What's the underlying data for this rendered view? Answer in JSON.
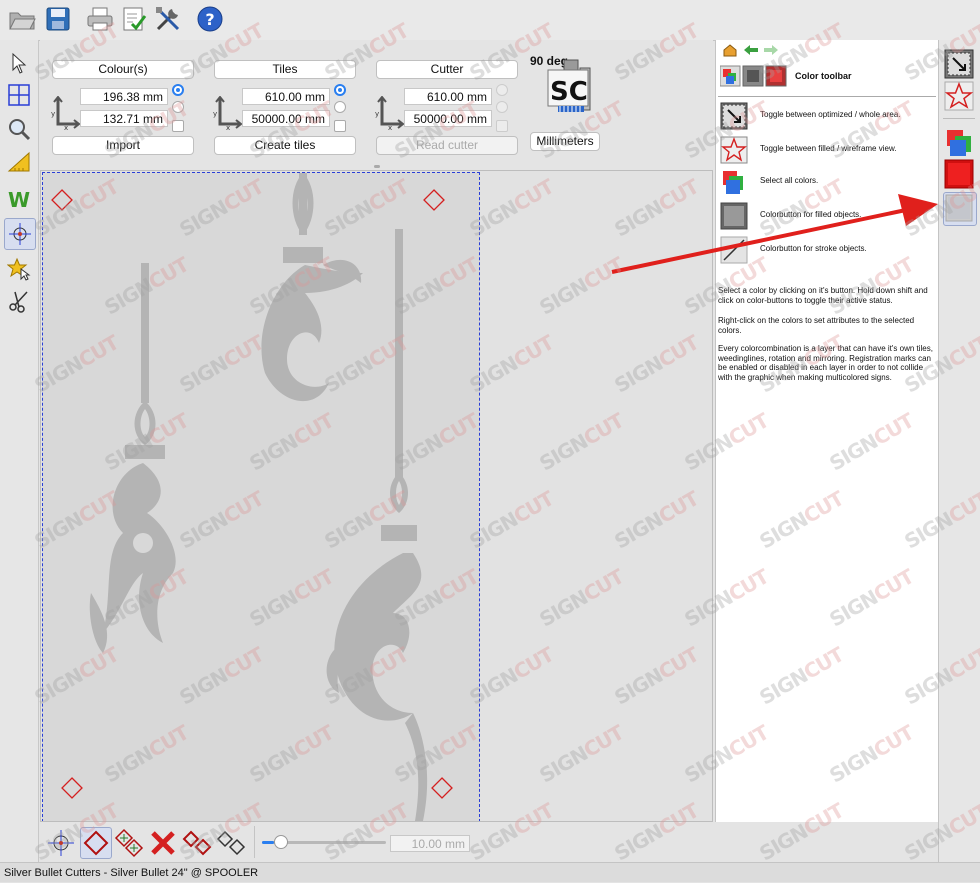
{
  "panel": {
    "colours": {
      "header": "Colour(s)",
      "x": "196.38 mm",
      "y": "132.71 mm",
      "button": "Import"
    },
    "tiles": {
      "header": "Tiles",
      "x": "610.00 mm",
      "y": "50000.00 mm",
      "button": "Create tiles"
    },
    "cutter": {
      "header": "Cutter",
      "x": "610.00 mm",
      "y": "50000.00 mm",
      "button": "Read cutter"
    },
    "rotation": "90 deg",
    "units_button": "Millimeters",
    "logo_text": "SC"
  },
  "help": {
    "title": "Color toolbar",
    "items": [
      {
        "icon": "optimized-area-icon",
        "text": "Toggle between optimized / whole area."
      },
      {
        "icon": "filled-wireframe-icon",
        "text": "Toggle between filled / wireframe view."
      },
      {
        "icon": "select-all-colors-icon",
        "text": "Select all colors."
      },
      {
        "icon": "filled-colorbutton-icon",
        "text": "Colorbutton for filled objects."
      },
      {
        "icon": "stroke-colorbutton-icon",
        "text": "Colorbutton for stroke objects."
      }
    ],
    "paragraphs": [
      "Select a color by clicking on it's button. Hold down shift and click on color-buttons to toggle their active status.",
      "Right-click on the colors to set attributes to the selected colors.",
      "Every colorcombination is a layer that can have it's own tiles, weedinglines, rotation and mirroring. Registration marks can be enabled or disabled in each layer in order to not collide with the graphic when making multicolored signs."
    ]
  },
  "bottom": {
    "zoom_value": "10.00 mm",
    "zoom_fraction": 0.1
  },
  "status": "Silver Bullet Cutters - Silver Bullet 24\" @ SPOOLER",
  "watermark": {
    "a": "SIGN",
    "b": "CUT"
  },
  "colors": {
    "accent": "#2a7ff0",
    "regmark": "#d42020",
    "page_border": "#2a3fd6",
    "arrow": "#e0201c"
  }
}
